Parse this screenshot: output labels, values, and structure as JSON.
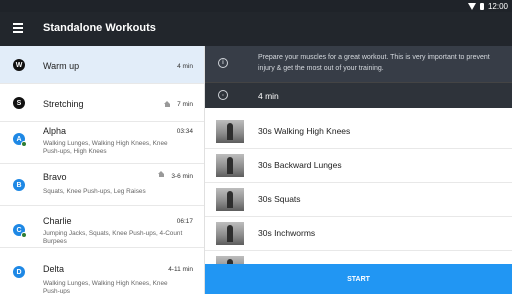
{
  "status_bar": {
    "time": "12:00"
  },
  "app_bar": {
    "title": "Standalone Workouts"
  },
  "workouts": [
    {
      "badge": "W",
      "name": "Warm up",
      "duration": "4 min",
      "selected": true
    },
    {
      "badge": "S",
      "name": "Stretching",
      "duration": "7 min",
      "home": true
    },
    {
      "badge": "A",
      "name": "Alpha",
      "duration": "03:34",
      "completed": true,
      "description": "Walking Lunges, Walking High Knees, Knee Push-ups, High Knees"
    },
    {
      "badge": "B",
      "name": "Bravo",
      "duration": "3-6 min",
      "home": true,
      "description": "Squats, Knee Push-ups, Leg Raises"
    },
    {
      "badge": "C",
      "name": "Charlie",
      "duration": "06:17",
      "completed": true,
      "description": "Jumping Jacks, Squats, Knee Push-ups, 4-Count Burpees"
    },
    {
      "badge": "D",
      "name": "Delta",
      "duration": "4-11 min",
      "description": "Walking Lunges, Walking High Knees, Knee Push-ups"
    }
  ],
  "detail": {
    "info_text": "Prepare your muscles for a great workout. This is very important to prevent injury & get the most out of your training.",
    "duration": "4 min",
    "exercises": [
      {
        "name": "30s Walking High Knees"
      },
      {
        "name": "30s Backward Lunges"
      },
      {
        "name": "30s Squats"
      },
      {
        "name": "30s Inchworms"
      }
    ],
    "start_label": "START"
  },
  "colors": {
    "accent": "#2196f3",
    "app_bar": "#22262c",
    "selected_row": "#e2edf9",
    "check": "#2e7d32"
  }
}
